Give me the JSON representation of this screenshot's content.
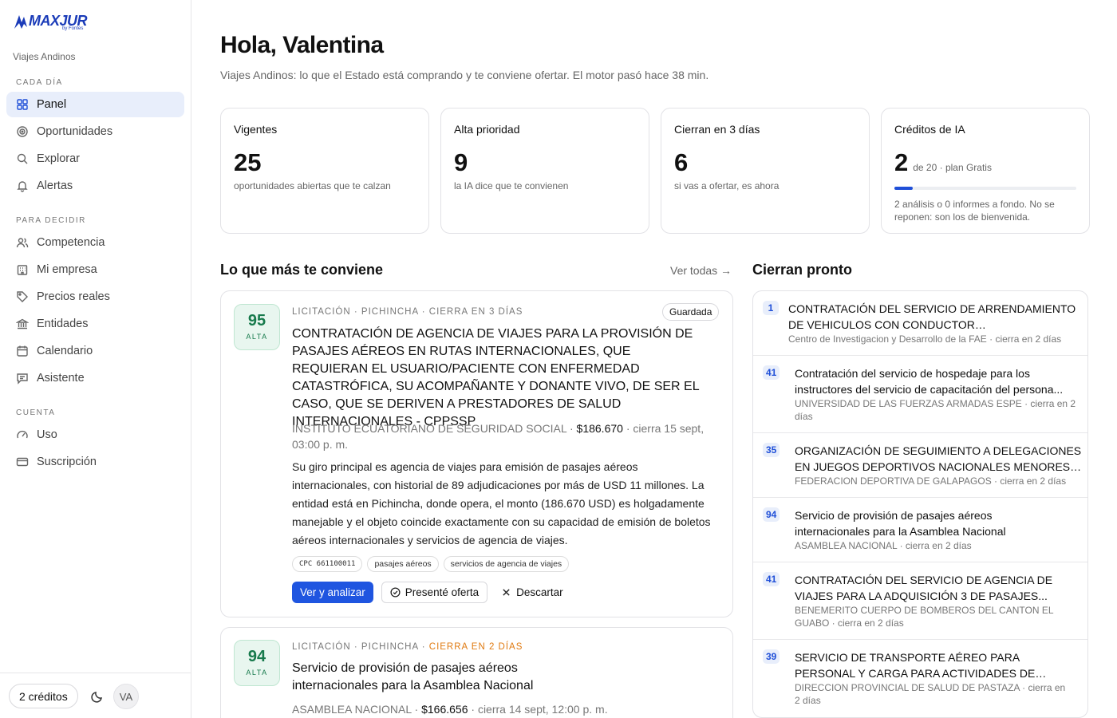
{
  "brand": {
    "name": "MAXJUR",
    "sub": "by Fontes"
  },
  "sidebar": {
    "org": "Viajes Andinos",
    "sections": [
      {
        "title": "CADA DÍA"
      },
      {
        "title": "PARA DECIDIR"
      },
      {
        "title": "CUENTA"
      }
    ],
    "items": [
      {
        "label": "Panel",
        "icon": "grid-icon"
      },
      {
        "label": "Oportunidades",
        "icon": "target-icon"
      },
      {
        "label": "Explorar",
        "icon": "search-icon"
      },
      {
        "label": "Alertas",
        "icon": "bell-icon"
      },
      {
        "label": "Competencia",
        "icon": "users-icon"
      },
      {
        "label": "Mi empresa",
        "icon": "building-icon"
      },
      {
        "label": "Precios reales",
        "icon": "tag-icon"
      },
      {
        "label": "Entidades",
        "icon": "landmark-icon"
      },
      {
        "label": "Calendario",
        "icon": "calendar-icon"
      },
      {
        "label": "Asistente",
        "icon": "message-icon"
      },
      {
        "label": "Uso",
        "icon": "gauge-icon"
      },
      {
        "label": "Suscripción",
        "icon": "card-icon"
      }
    ],
    "footer": {
      "credits": "2 créditos",
      "avatar": "VA"
    }
  },
  "header": {
    "greeting": "Hola, Valentina",
    "subtitle": "Viajes Andinos: lo que el Estado está comprando y te conviene ofertar. El motor pasó hace 38 min."
  },
  "stats": [
    {
      "label": "Vigentes",
      "value": "25",
      "desc": "oportunidades abiertas que te calzan"
    },
    {
      "label": "Alta prioridad",
      "value": "9",
      "desc": "la IA dice que te convienen"
    },
    {
      "label": "Cierran en 3 días",
      "value": "6",
      "desc": "si vas a ofertar, es ahora"
    },
    {
      "label": "Créditos de IA",
      "value": "2",
      "suffix": "de 20 · plan Gratis",
      "progress": 0.1,
      "desc": "2 análisis o 0 informes a fondo. No se reponen: son los de bienvenida."
    }
  ],
  "best": {
    "title": "Lo que más te conviene",
    "see_all": "Ver todas →",
    "cards": [
      {
        "score": "95",
        "level": "ALTA",
        "meta_a": "LICITACIÓN · PICHINCHA ·",
        "meta_b": "CIERRA EN 3 DÍAS",
        "badge": "Guardada",
        "title": "CONTRATACIÓN DE AGENCIA DE VIAJES PARA LA PROVISIÓN DE PASAJES AÉREOS EN RUTAS INTERNACIONALES, QUE REQUIERAN EL USUARIO/PACIENTE CON ENFERMEDAD CATASTRÓFICA, SU ACOMPAÑANTE Y DONANTE VIVO, DE SER EL CASO, QUE SE DERIVEN A PRESTADORES DE SALUD INTERNACIONALES - CPPSSP",
        "entity": "INSTITUTO ECUATORIANO DE SEGURIDAD SOCIAL ·",
        "amount": "$186.670",
        "close": "· cierra 15 sept, 03:00 p. m.",
        "body": "Su giro principal es agencia de viajes para emisión de pasajes aéreos internacionales, con historial de 89 adjudicaciones por más de USD 11 millones. La entidad está en Pichincha, donde opera, el monto (186.670 USD) es holgadamente manejable y el objeto coincide exactamente con su capacidad de emisión de boletos aéreos internacionales y servicios de agencia de viajes.",
        "tags": [
          "CPC 661100011",
          "pasajes aéreos",
          "servicios de agencia de viajes"
        ],
        "actions": {
          "analyze": "Ver y analizar",
          "offered": "Presenté oferta",
          "discard": "Descartar"
        }
      },
      {
        "score": "94",
        "level": "ALTA",
        "meta_a": "LICITACIÓN · PICHINCHA ·",
        "meta_b": "CIERRA EN 2 DÍAS",
        "title": "Servicio de provisión de pasajes aéreos internacionales para la Asamblea Nacional",
        "entity": "ASAMBLEA NACIONAL ·",
        "amount": "$166.656",
        "close": "· cierra 14 sept, 12:00 p. m."
      }
    ]
  },
  "closing": {
    "title": "Cierran pronto",
    "items": [
      {
        "rank": "1",
        "title": "CONTRATACIÓN DEL SERVICIO DE ARRENDAMIENTO DE VEHICULOS CON CONDUCTOR GENERALMENTE...",
        "sub": "Centro de Investigacion y Desarrollo de la FAE · cierra en 2 días"
      },
      {
        "rank": "41",
        "title": "Contratación del servicio de hospedaje para los instructores del servicio de capacitación del persona...",
        "sub": "UNIVERSIDAD DE LAS FUERZAS ARMADAS ESPE · cierra en 2 días"
      },
      {
        "rank": "35",
        "title": "ORGANIZACIÓN DE SEGUIMIENTO A DELEGACIONES EN JUEGOS DEPORTIVOS NACIONALES MENORES -...",
        "sub": "FEDERACION DEPORTIVA DE GALAPAGOS · cierra en 2 días"
      },
      {
        "rank": "94",
        "title": "Servicio de provisión de pasajes aéreos internacionales para la Asamblea Nacional",
        "sub": "ASAMBLEA NACIONAL · cierra en 2 días"
      },
      {
        "rank": "41",
        "title": "CONTRATACIÓN DEL SERVICIO DE AGENCIA DE VIAJES PARA LA ADQUISICIÓN 3 DE PASAJES...",
        "sub": "BENEMERITO CUERPO DE BOMBEROS DEL CANTON EL GUABO · cierra en 2 días"
      },
      {
        "rank": "39",
        "title": "SERVICIO DE TRANSPORTE AÉREO PARA PERSONAL Y CARGA PARA ACTIVIDADES DE MALARIA",
        "sub": "DIRECCION PROVINCIAL DE SALUD DE PASTAZA · cierra en 2 días"
      }
    ]
  },
  "colors": {
    "accent": "#1f55e0",
    "score_green": "#177a4c",
    "warning": "#e07a10",
    "active_nav_bg": "#e8eefb"
  }
}
